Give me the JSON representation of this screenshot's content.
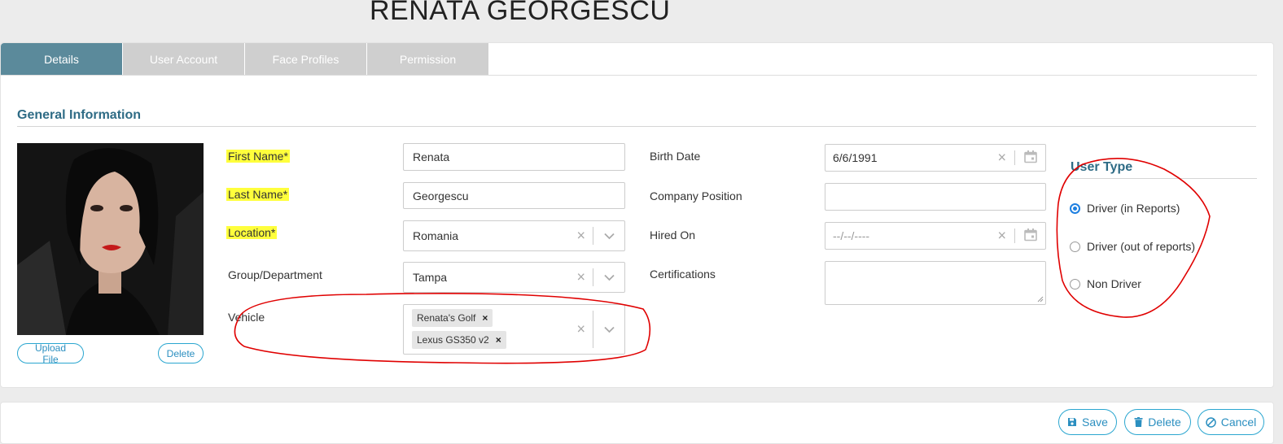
{
  "header": {
    "title": "RENATA GEORGESCU"
  },
  "tabs": [
    {
      "label": "Details",
      "active": true
    },
    {
      "label": "User Account",
      "active": false
    },
    {
      "label": "Face Profiles",
      "active": false
    },
    {
      "label": "Permission",
      "active": false
    }
  ],
  "section": {
    "title": "General Information"
  },
  "photo": {
    "upload_label": "Upload File",
    "delete_label": "Delete"
  },
  "form": {
    "first_name": {
      "label": "First Name*",
      "value": "Renata"
    },
    "last_name": {
      "label": "Last Name*",
      "value": "Georgescu"
    },
    "location": {
      "label": "Location*",
      "value": "Romania"
    },
    "group": {
      "label": "Group/Department",
      "value": "Tampa"
    },
    "vehicle": {
      "label": "Vehicle",
      "chips": [
        "Renata's Golf",
        "Lexus GS350 v2"
      ]
    },
    "birth_date": {
      "label": "Birth Date",
      "value": "6/6/1991"
    },
    "company_position": {
      "label": "Company Position",
      "value": ""
    },
    "hired_on": {
      "label": "Hired On",
      "placeholder": "--/--/----"
    },
    "certifications": {
      "label": "Certifications",
      "value": ""
    }
  },
  "user_type": {
    "title": "User Type",
    "options": [
      {
        "label": "Driver (in Reports)",
        "checked": true
      },
      {
        "label": "Driver (out of reports)",
        "checked": false
      },
      {
        "label": "Non Driver",
        "checked": false
      }
    ]
  },
  "footer": {
    "save_label": "Save",
    "delete_label": "Delete",
    "cancel_label": "Cancel"
  },
  "colors": {
    "accent": "#2b8fc0",
    "active_tab": "#5b8a9b",
    "highlight": "#ffff3c",
    "annotation": "#e00000"
  }
}
